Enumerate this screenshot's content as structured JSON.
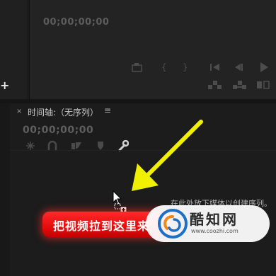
{
  "program_monitor": {
    "timecode": "00;00;00;00",
    "controls": {
      "export_frame": "export-frame-icon",
      "mark_in": "{",
      "mark_out": "}",
      "go_to_in": "go-to-in-icon",
      "step_back": "step-back-icon",
      "play": "play-icon",
      "lift": "lift-icon",
      "extract": "extract-icon",
      "compare": "compare-icon"
    }
  },
  "left_panel": {
    "add_icon": "+"
  },
  "timeline": {
    "close_glyph": "×",
    "title": "时间轴:（无序列）",
    "menu_glyph": "≡",
    "timecode": "00;00;00;00",
    "tools": [
      "snap-icon",
      "magnet-icon",
      "linked-selection-icon",
      "marker-icon",
      "wrench-icon"
    ],
    "drop_hint": "在此处放下媒体以创建序列。"
  },
  "annotation": {
    "banner_text": "把视频拉到这里来",
    "banner_color": "#e60d0d",
    "arrow_color": "#f0f000"
  },
  "watermark": {
    "name": "酷知网",
    "url": "www.coozhi.com"
  }
}
